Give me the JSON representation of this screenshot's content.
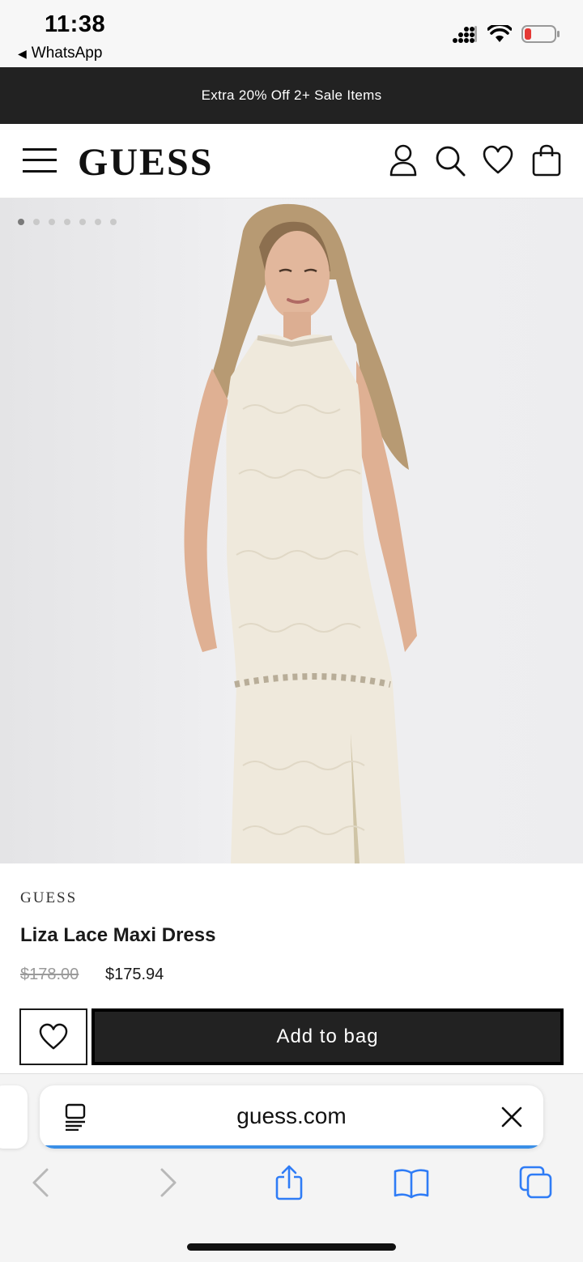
{
  "status_bar": {
    "time": "11:38",
    "back_app": "WhatsApp",
    "icons": [
      "signal-icon",
      "wifi-icon",
      "battery-icon"
    ]
  },
  "promo": {
    "text": "Extra 20% Off 2+ Sale Items"
  },
  "header": {
    "logo": "GUESS",
    "icons": [
      "menu-icon",
      "account-icon",
      "search-icon",
      "wishlist-icon",
      "bag-icon"
    ]
  },
  "gallery": {
    "total_images": 7,
    "active_index": 0
  },
  "product": {
    "brand": "GUESS",
    "name": "Liza Lace Maxi Dress",
    "original_price": "$178.00",
    "sale_price": "$175.94",
    "add_to_bag_label": "Add to bag"
  },
  "browser": {
    "url": "guess.com",
    "load_progress": 1.0
  },
  "colors": {
    "promo_bg": "#222222",
    "button_bg": "#222222",
    "progress": "#3a8ee6",
    "safari_icon": "#2f7cf6"
  }
}
